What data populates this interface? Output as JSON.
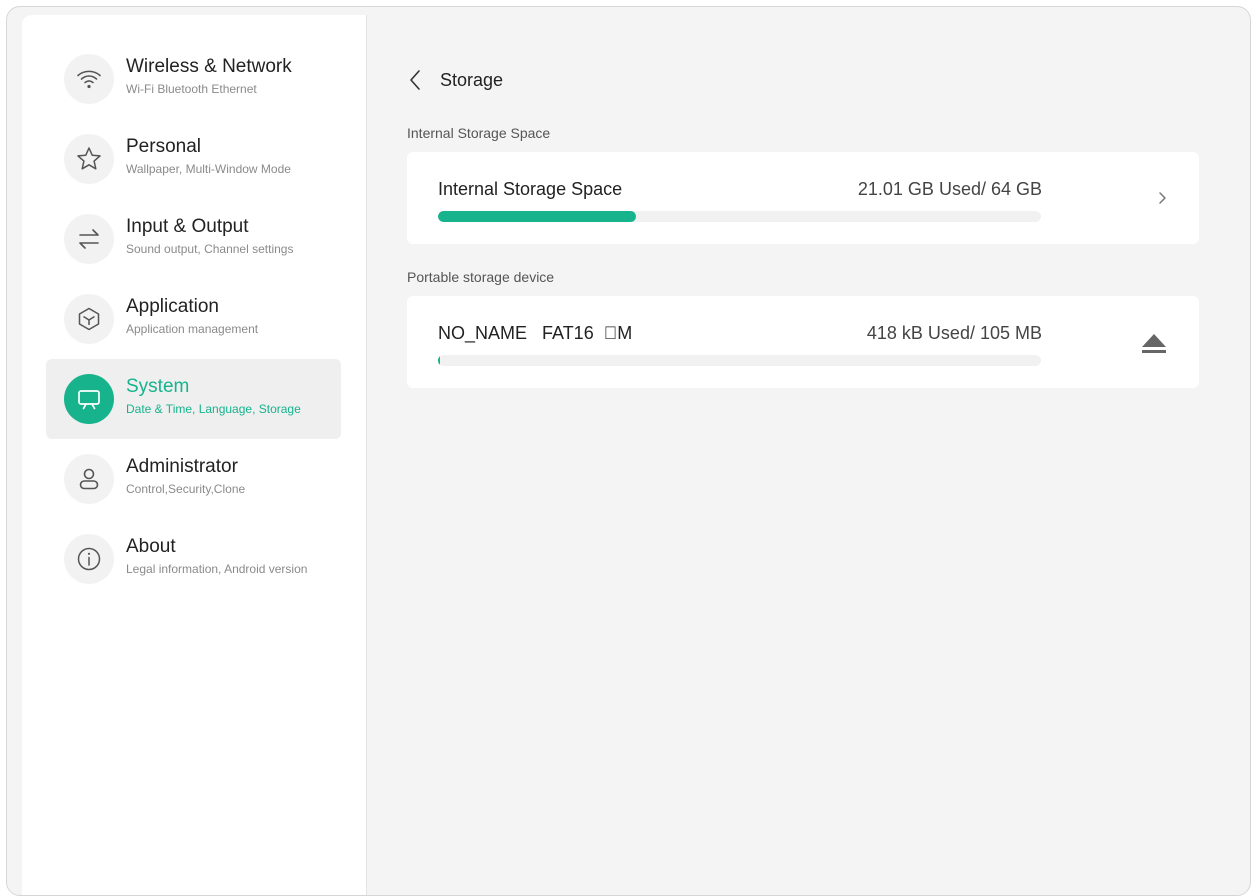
{
  "sidebar": {
    "items": [
      {
        "title": "Wireless & Network",
        "subtitle": "Wi-Fi Bluetooth Ethernet",
        "icon": "wifi-icon"
      },
      {
        "title": "Personal",
        "subtitle": "Wallpaper, Multi-Window Mode",
        "icon": "star-icon"
      },
      {
        "title": "Input & Output",
        "subtitle": "Sound output, Channel settings",
        "icon": "swap-arrows-icon"
      },
      {
        "title": "Application",
        "subtitle": "Application management",
        "icon": "cube-icon"
      },
      {
        "title": "System",
        "subtitle": "Date & Time, Language, Storage",
        "icon": "display-icon",
        "active": true
      },
      {
        "title": "Administrator",
        "subtitle": "Control,Security,Clone",
        "icon": "user-icon"
      },
      {
        "title": "About",
        "subtitle": "Legal information, Android version",
        "icon": "info-icon"
      }
    ]
  },
  "header": {
    "title": "Storage"
  },
  "internal": {
    "section_label": "Internal Storage Space",
    "name": "Internal Storage Space",
    "usage": "21.01 GB Used/ 64 GB",
    "used_fraction": 0.328
  },
  "portable": {
    "section_label": "Portable storage device",
    "name": "NO_NAME   FAT16  \u0000M",
    "usage": "418 kB Used/ 105 MB",
    "used_fraction": 0.004
  },
  "colors": {
    "accent": "#17b38d",
    "icon_gray": "#555555"
  }
}
